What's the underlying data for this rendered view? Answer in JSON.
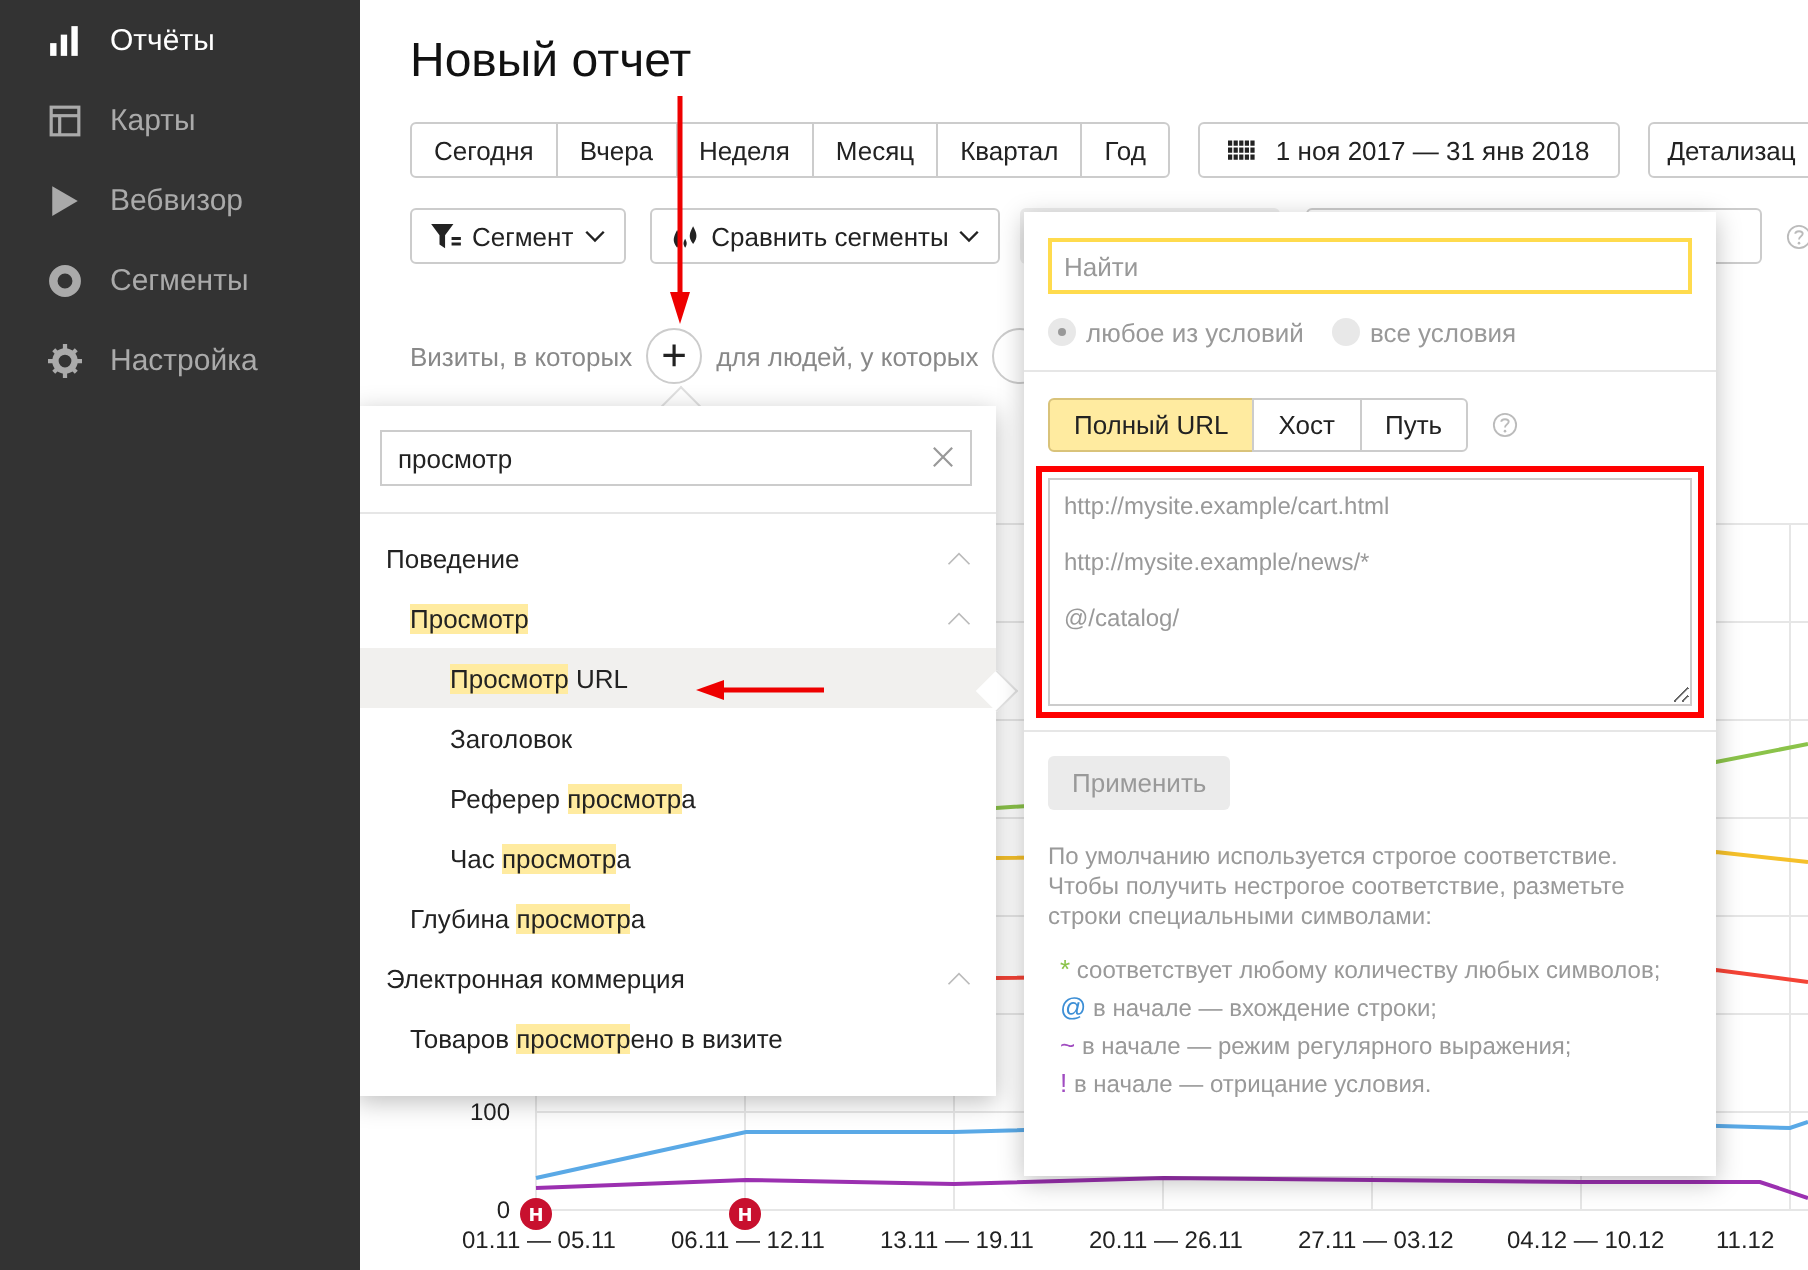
{
  "sidebar": {
    "items": [
      {
        "label": "Отчёты",
        "kind": "bars",
        "selected": true
      },
      {
        "label": "Карты",
        "kind": "map",
        "selected": false
      },
      {
        "label": "Вебвизор",
        "kind": "play",
        "selected": false
      },
      {
        "label": "Сегменты",
        "kind": "ring",
        "selected": false
      },
      {
        "label": "Настройка",
        "kind": "gear",
        "selected": false
      }
    ]
  },
  "title": "Новый отчет",
  "periods": [
    {
      "label": "Сегодня",
      "selected": false
    },
    {
      "label": "Вчера",
      "selected": false
    },
    {
      "label": "Неделя",
      "selected": false
    },
    {
      "label": "Месяц",
      "selected": false
    },
    {
      "label": "Квартал",
      "selected": false
    },
    {
      "label": "Год",
      "selected": false
    }
  ],
  "date_range": "1 ноя 2017 — 31 янв 2018",
  "detail_button": "Детализац",
  "segment_button": "Сегмент",
  "compare_button": "Сравнить сегменты",
  "condition_row": {
    "visits_label": "Визиты, в которых",
    "add_button": "+",
    "people_label": "для людей, у которых"
  },
  "chart": {
    "yticks": [
      "100",
      "0"
    ],
    "xlabels": [
      {
        "label": "01.11 — 05.11",
        "marker": "Н"
      },
      {
        "label": "06.11 — 12.11",
        "marker": "Н"
      },
      {
        "label": "13.11 — 19.11"
      },
      {
        "label": "20.11 — 26.11"
      },
      {
        "label": "27.11 — 03.12"
      },
      {
        "label": "04.12 — 10.12"
      },
      {
        "label": "11.12"
      }
    ]
  },
  "attribute_menu": {
    "search_value": "просмотр",
    "tree": [
      {
        "parts": [
          {
            "text": "Поведение",
            "match": false
          }
        ],
        "expanded": true,
        "selected": false,
        "children": [
          {
            "parts": [
              {
                "text": "Просмотр",
                "match": true
              }
            ],
            "expanded": true,
            "selected": false,
            "children": [
              {
                "parts": [
                  {
                    "text": "Просмотр",
                    "match": true
                  },
                  {
                    "text": " URL",
                    "match": false
                  }
                ],
                "selected": true
              },
              {
                "parts": [
                  {
                    "text": "Заголовок",
                    "match": false
                  }
                ],
                "selected": false
              },
              {
                "parts": [
                  {
                    "text": "Реферер ",
                    "match": false
                  },
                  {
                    "text": "просмотр",
                    "match": true
                  },
                  {
                    "text": "а",
                    "match": false
                  }
                ],
                "selected": false
              },
              {
                "parts": [
                  {
                    "text": "Час ",
                    "match": false
                  },
                  {
                    "text": "просмотр",
                    "match": true
                  },
                  {
                    "text": "а",
                    "match": false
                  }
                ],
                "selected": false
              }
            ]
          },
          {
            "parts": [
              {
                "text": "Глубина ",
                "match": false
              },
              {
                "text": "просмотр",
                "match": true
              },
              {
                "text": "а",
                "match": false
              }
            ],
            "selected": false
          }
        ]
      },
      {
        "parts": [
          {
            "text": "Электронная коммерция",
            "match": false
          }
        ],
        "expanded": true,
        "selected": false,
        "children": [
          {
            "parts": [
              {
                "text": "Товаров ",
                "match": false
              },
              {
                "text": "просмотр",
                "match": true
              },
              {
                "text": "ено в визите",
                "match": false
              }
            ],
            "selected": false
          }
        ]
      }
    ]
  },
  "condition_popup": {
    "search_placeholder": "Найти",
    "match_modes": [
      {
        "label": "любое из условий",
        "selected": true
      },
      {
        "label": "все условия",
        "selected": false
      }
    ],
    "url_tabs": [
      {
        "label": "Полный URL",
        "selected": true
      },
      {
        "label": "Хост",
        "selected": false
      },
      {
        "label": "Путь",
        "selected": false
      }
    ],
    "values_placeholder": "http://mysite.example/cart.html\n\nhttp://mysite.example/news/*\n\n@/catalog/",
    "apply_button": {
      "label": "Применить",
      "disabled": true
    },
    "help_text": "По умолчанию используется строгое соответствие. Чтобы получить нестрогое соответствие, разметьте строки специальными символами:",
    "hints": [
      {
        "symbol": "*",
        "color": "#8bc34a",
        "text": "соответствует любому количеству любых символов;"
      },
      {
        "symbol": "@",
        "color": "#3d8fd6",
        "text": "в начале — вхождение строки;"
      },
      {
        "symbol": "~",
        "color": "#a04cc0",
        "text": "в начале — режим регулярного выражения;"
      },
      {
        "symbol": "!",
        "color": "#a04cc1",
        "text": "в начале — отрицание условия."
      }
    ]
  }
}
